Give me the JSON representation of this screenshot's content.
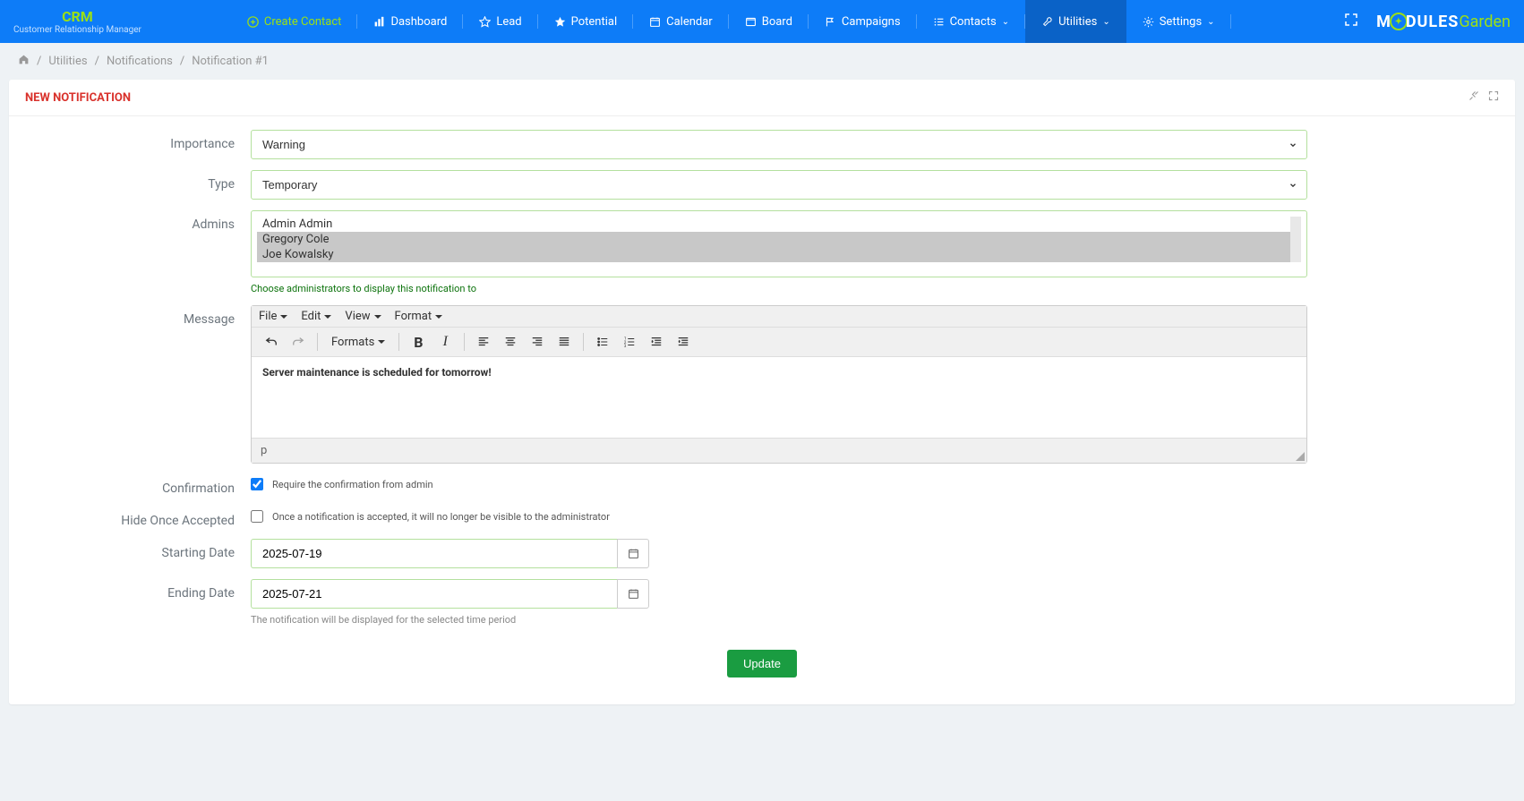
{
  "header": {
    "title": "CRM",
    "subtitle": "Customer Relationship Manager",
    "nav": {
      "create": "Create Contact",
      "dashboard": "Dashboard",
      "lead": "Lead",
      "potential": "Potential",
      "calendar": "Calendar",
      "board": "Board",
      "campaigns": "Campaigns",
      "contacts": "Contacts",
      "utilities": "Utilities",
      "settings": "Settings"
    },
    "logo1": "M",
    "logo2": "DULES",
    "logo3": "Garden"
  },
  "breadcrumb": {
    "sep": "/",
    "utilities": "Utilities",
    "notifications": "Notifications",
    "current": "Notification #1"
  },
  "panel": {
    "title": "NEW NOTIFICATION"
  },
  "form": {
    "importance": {
      "label": "Importance",
      "value": "Warning"
    },
    "type": {
      "label": "Type",
      "value": "Temporary"
    },
    "admins": {
      "label": "Admins",
      "options": [
        "Admin Admin",
        "Gregory Cole",
        "Joe Kowalsky"
      ],
      "help": "Choose administrators to display this notification to"
    },
    "message": {
      "label": "Message",
      "menu": {
        "file": "File",
        "edit": "Edit",
        "view": "View",
        "format": "Format"
      },
      "formats": "Formats",
      "content": "Server maintenance is scheduled for tomorrow!",
      "status": "p"
    },
    "confirmation": {
      "label": "Confirmation",
      "text": "Require the confirmation from admin"
    },
    "hideOnce": {
      "label": "Hide Once Accepted",
      "text": "Once a notification is accepted, it will no longer be visible to the administrator"
    },
    "startDate": {
      "label": "Starting Date",
      "value": "2025-07-19"
    },
    "endDate": {
      "label": "Ending Date",
      "value": "2025-07-21",
      "help": "The notification will be displayed for the selected time period"
    },
    "submit": "Update"
  }
}
